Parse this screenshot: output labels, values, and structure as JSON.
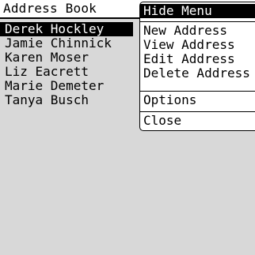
{
  "app": {
    "title": "Address Book"
  },
  "contacts": [
    {
      "name": "Derek Hockley"
    },
    {
      "name": "Jamie Chinnick"
    },
    {
      "name": "Karen Moser"
    },
    {
      "name": "Liz Eacrett"
    },
    {
      "name": "Marie Demeter"
    },
    {
      "name": "Tanya Busch"
    }
  ],
  "selected_contact": "Derek Hockley",
  "menu": {
    "header": "Hide Menu",
    "actions": [
      {
        "label": "New Address"
      },
      {
        "label": "View Address"
      },
      {
        "label": "Edit Address"
      },
      {
        "label": "Delete Address"
      }
    ],
    "options": "Options",
    "close": "Close"
  },
  "colors": {
    "background": "#d8d8d8",
    "highlight": "#000000",
    "highlight_text": "#ffffff",
    "panel": "#ffffff"
  }
}
